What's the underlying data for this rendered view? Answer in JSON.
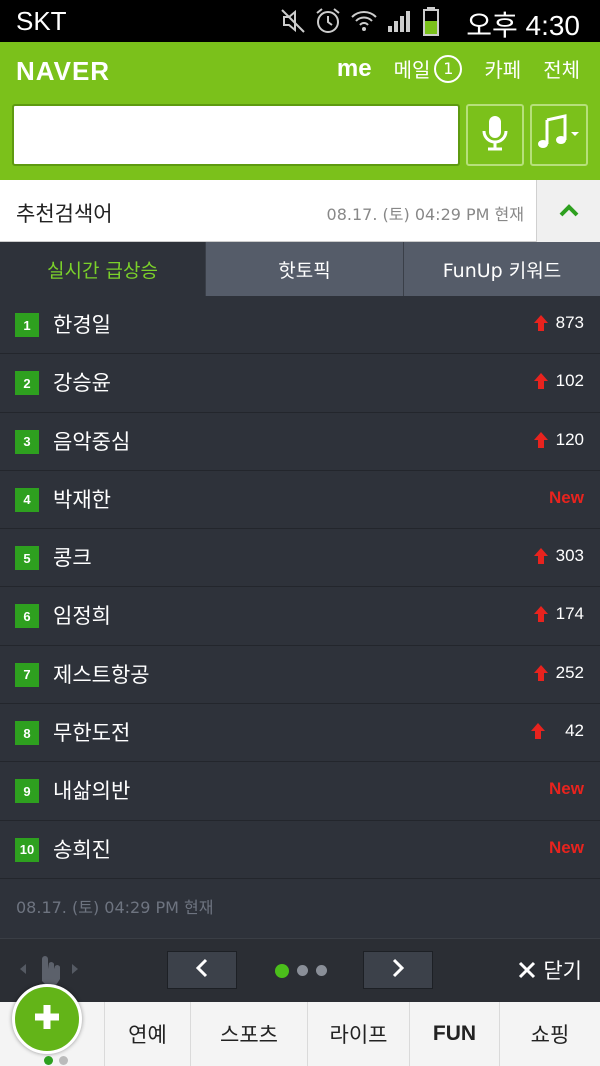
{
  "status_bar": {
    "carrier": "SKT",
    "time": "오후 4:30",
    "icons": [
      "mute-icon",
      "alarm-icon",
      "wifi-icon",
      "signal-icon",
      "battery-icon"
    ]
  },
  "header": {
    "logo": "NAVER",
    "me": "me",
    "mail_label": "메일",
    "mail_count": "1",
    "cafe": "카페",
    "all": "전체",
    "search_value": "",
    "accent_color": "#7bc11b"
  },
  "recommend": {
    "title": "추천검색어",
    "timestamp": "08.17. (토) 04:29 PM 현재"
  },
  "tabs": [
    {
      "label": "실시간 급상승",
      "active": true
    },
    {
      "label": "핫토픽",
      "active": false
    },
    {
      "label": "FunUp 키워드",
      "active": false
    }
  ],
  "ranking": [
    {
      "rank": "1",
      "keyword": "한경일",
      "change": "873",
      "type": "up"
    },
    {
      "rank": "2",
      "keyword": "강승윤",
      "change": "102",
      "type": "up"
    },
    {
      "rank": "3",
      "keyword": "음악중심",
      "change": "120",
      "type": "up"
    },
    {
      "rank": "4",
      "keyword": "박재한",
      "change": "New",
      "type": "new"
    },
    {
      "rank": "5",
      "keyword": "콩크",
      "change": "303",
      "type": "up"
    },
    {
      "rank": "6",
      "keyword": "임정희",
      "change": "174",
      "type": "up"
    },
    {
      "rank": "7",
      "keyword": "제스트항공",
      "change": "252",
      "type": "up"
    },
    {
      "rank": "8",
      "keyword": "무한도전",
      "change": "42",
      "type": "up"
    },
    {
      "rank": "9",
      "keyword": "내삶의반",
      "change": "New",
      "type": "new"
    },
    {
      "rank": "10",
      "keyword": "송희진",
      "change": "New",
      "type": "new"
    }
  ],
  "list_footer": "08.17. (토) 04:29 PM 현재",
  "pager": {
    "page_count": 3,
    "current_page": 1,
    "close_label": "닫기"
  },
  "bottom_nav": {
    "items": [
      "연예",
      "스포츠",
      "라이프",
      "FUN",
      "쇼핑"
    ],
    "fab_dots": 2
  }
}
